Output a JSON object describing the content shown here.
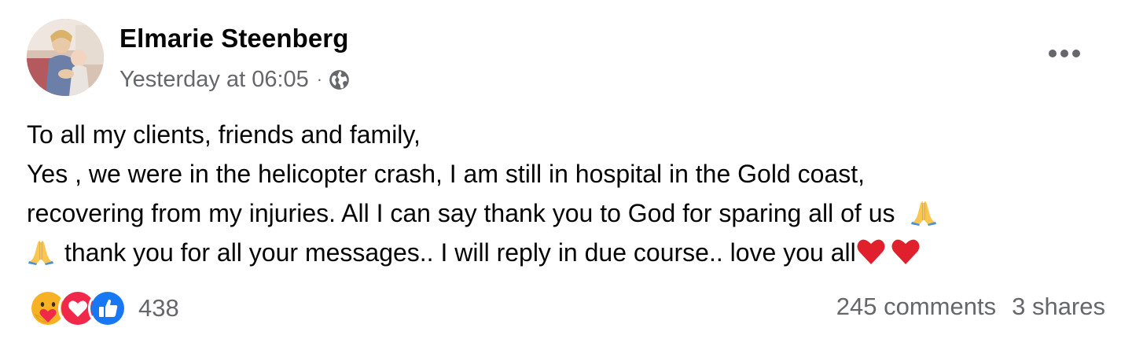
{
  "post": {
    "author": {
      "name": "Elmarie Steenberg"
    },
    "meta": {
      "timestamp": "Yesterday at 06:05",
      "separator": "·",
      "privacy_icon": "globe-icon"
    },
    "more_icon": "more-horizontal-icon",
    "text_lines": [
      "To all my clients, friends and family,",
      "Yes , we were in the helicopter crash, I am still in hospital in the Gold coast,",
      "recovering from my injuries. All I can say thank you to God for sparing all of us",
      "thank you for all your messages.. I will reply in due course.. love you all"
    ],
    "emojis": {
      "prayer": "folded-hands-emoji",
      "heart": "red-heart-emoji"
    },
    "reactions": {
      "icons": [
        "care-reaction-icon",
        "love-reaction-icon",
        "like-reaction-icon"
      ],
      "count": "438"
    },
    "engagement": {
      "comments": "245 comments",
      "shares": "3 shares"
    },
    "colors": {
      "text_primary": "#050505",
      "text_secondary": "#65676b",
      "like_blue": "#1877f2",
      "love_red": "#f02849",
      "care_yellow": "#f7b125"
    }
  }
}
